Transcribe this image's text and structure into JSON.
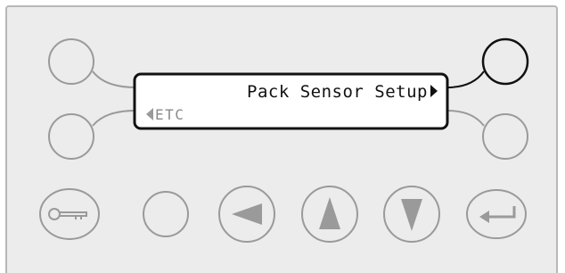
{
  "display": {
    "line1": "Pack Sensor Setup",
    "line2": "ETC",
    "line1_right_arrow_icon": "right-triangle-icon",
    "line2_left_arrow_icon": "left-triangle-icon"
  },
  "softkeys": {
    "top_left": {
      "active": false
    },
    "top_right": {
      "active": true
    },
    "bottom_left": {
      "active": false
    },
    "bottom_right": {
      "active": false
    }
  },
  "bottom_buttons": [
    {
      "name": "key-button",
      "icon": "key-icon"
    },
    {
      "name": "blank-button",
      "icon": ""
    },
    {
      "name": "left-arrow-button",
      "icon": "left-arrow-icon"
    },
    {
      "name": "up-arrow-button",
      "icon": "up-arrow-icon"
    },
    {
      "name": "down-arrow-button",
      "icon": "down-arrow-icon"
    },
    {
      "name": "enter-button",
      "icon": "enter-icon"
    }
  ],
  "colors": {
    "panel_background": "#ececec",
    "inactive_stroke": "#9a9a9a",
    "active_stroke": "#111111",
    "lcd_inactive_text": "#8a8a8a"
  }
}
